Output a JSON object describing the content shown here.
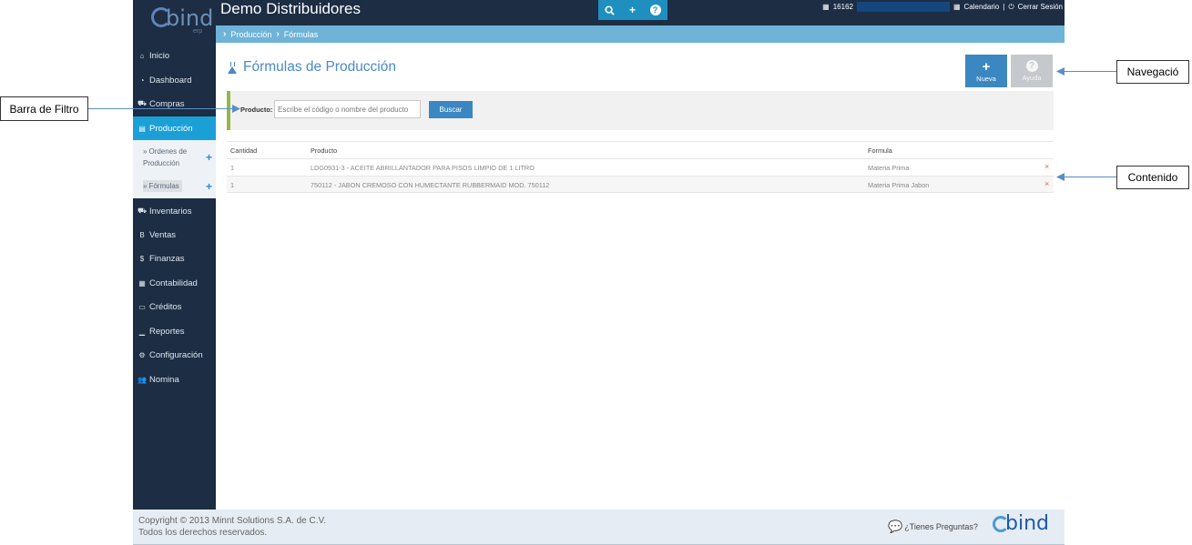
{
  "app": {
    "logo_text": "bind",
    "logo_sub": "erp",
    "company": "Demo Distribuidores"
  },
  "header": {
    "actions": [
      {
        "icon": "search-icon",
        "glyph": "🔍"
      },
      {
        "icon": "plus-icon",
        "glyph": "+"
      },
      {
        "icon": "help-icon",
        "glyph": "?"
      }
    ],
    "account_number": "16162",
    "calendar_label": "Calendario",
    "logout_label": "Cerrar Sesión",
    "separator": "|"
  },
  "breadcrumb": {
    "items": [
      "Producción",
      "Fórmulas"
    ]
  },
  "sidebar": {
    "items": [
      {
        "label": "Inicio",
        "icon": "home-icon",
        "glyph": "⌂"
      },
      {
        "label": "Dashboard",
        "icon": "dashboard-icon",
        "glyph": "◔"
      },
      {
        "label": "Compras",
        "icon": "cart-icon",
        "glyph": "⛟"
      },
      {
        "label": "Producción",
        "icon": "production-icon",
        "glyph": "▤",
        "active": true
      },
      {
        "label": "Inventarios",
        "icon": "truck-icon",
        "glyph": "⛟"
      },
      {
        "label": "Ventas",
        "icon": "sales-icon",
        "glyph": "B"
      },
      {
        "label": "Finanzas",
        "icon": "dollar-icon",
        "glyph": "$"
      },
      {
        "label": "Contabilidad",
        "icon": "calculator-icon",
        "glyph": "▦"
      },
      {
        "label": "Créditos",
        "icon": "credit-card-icon",
        "glyph": "▭"
      },
      {
        "label": "Reportes",
        "icon": "signal-icon",
        "glyph": "▁"
      },
      {
        "label": "Configuración",
        "icon": "gears-icon",
        "glyph": "⚙"
      },
      {
        "label": "Nomina",
        "icon": "users-icon",
        "glyph": "👥"
      }
    ],
    "submenu": [
      {
        "label": "Ordenes de Producción",
        "marker": "»",
        "plus": "+"
      },
      {
        "label": "Fórmulas",
        "marker": "»",
        "plus": "+"
      }
    ]
  },
  "main": {
    "title": "Fórmulas de Producción",
    "buttons": {
      "new_label": "Nueva",
      "new_glyph": "+",
      "help_label": "Ayuda",
      "help_glyph": "?"
    },
    "filter": {
      "label": "Producto:",
      "placeholder": "Escribe el código o nombre del producto",
      "value": "",
      "search_label": "Buscar"
    },
    "table": {
      "headers": [
        "Cantidad",
        "Producto",
        "Formula"
      ],
      "rows": [
        {
          "cantidad": "1",
          "producto": "LDG0931-3 - ACEITE ABRILLANTADOR PARA PISOS LIMPIO DE 1 LITRO",
          "formula": "Materia Prima"
        },
        {
          "cantidad": "1",
          "producto": "750112 - JABON CREMOSO CON HUMECTANTE RUBBERMAID MOD. 750112",
          "formula": "Materia Prima Jabon"
        }
      ],
      "delete_glyph": "×"
    }
  },
  "footer": {
    "copyright_line1": "Copyright © 2013 Minnt Solutions S.A. de C.V.",
    "copyright_line2": "Todos los derechos reservados.",
    "questions_label": "¿Tienes Preguntas?",
    "logo_text": "bind"
  },
  "annotations": {
    "filter_bar": "Barra de Filtro",
    "navigation": "Navegació",
    "content": "Contenido"
  },
  "colors": {
    "sidebar_bg": "#1c2d44",
    "active_item": "#1aa0d6",
    "breadcrumb_bg": "#6fb3d8",
    "primary_button": "#3b87c1",
    "filter_accent": "#93b84a",
    "annotation_line": "#5b8ec9"
  }
}
